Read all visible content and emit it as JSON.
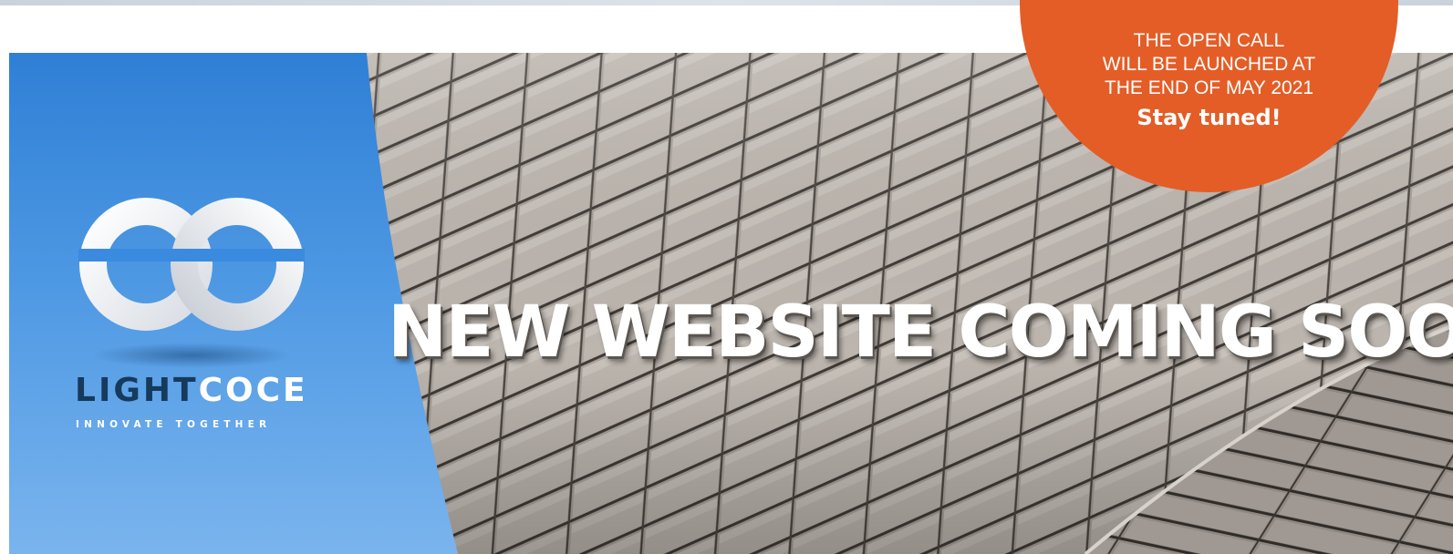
{
  "banner": {
    "headline": "NEW WEBSITE COMING SOON!",
    "background_description_colors": {
      "sky": "#4d98e3",
      "facade": "#a7a09a",
      "badge": "#e45d26"
    }
  },
  "brand": {
    "name_part1": "LIGHT",
    "name_part2": "COCE",
    "tagline": "INNOVATE TOGETHER",
    "logo_icon": "oc-logo-icon"
  },
  "announcement": {
    "line1": "THE OPEN CALL",
    "line2": "WILL BE LAUNCHED AT",
    "line3": "THE END OF MAY 2021",
    "cta": "Stay tuned!"
  }
}
